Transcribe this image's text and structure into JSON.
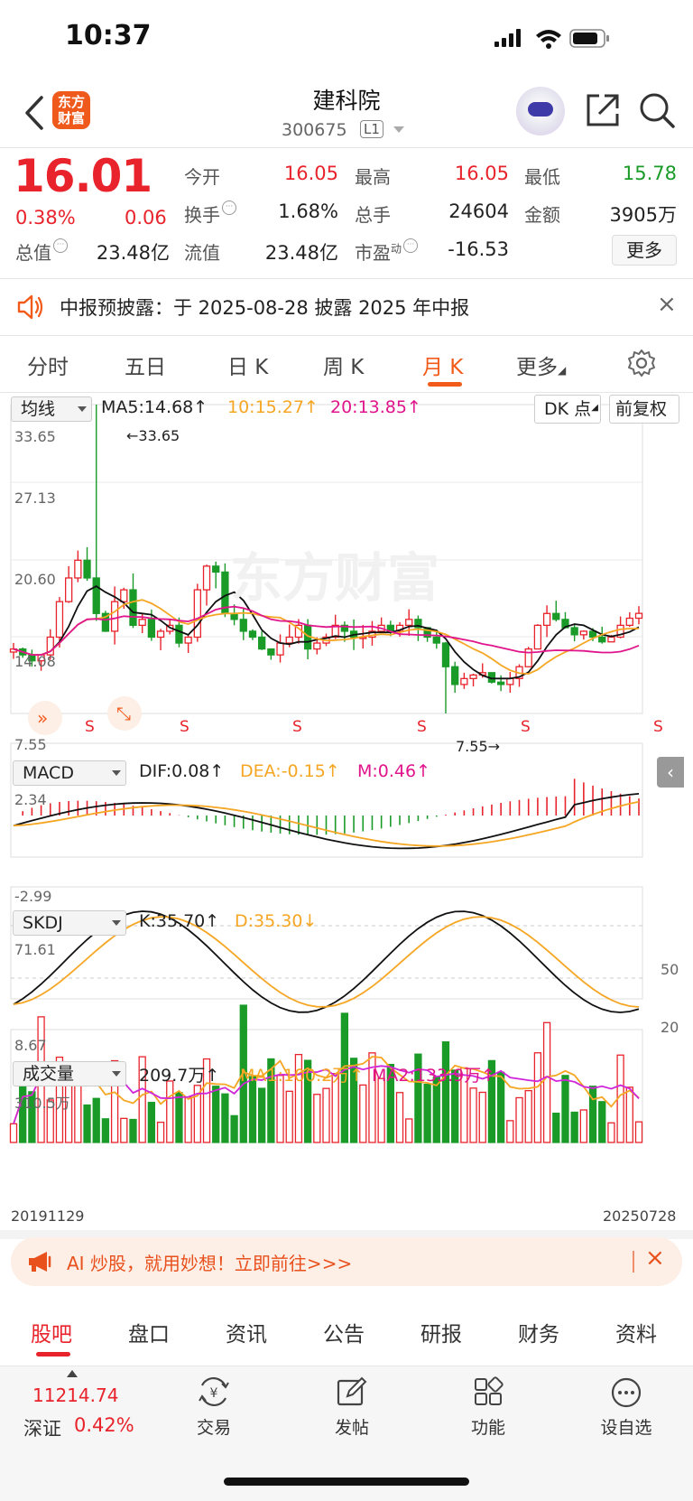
{
  "status_bar": {
    "time": "10:37"
  },
  "header": {
    "name": "建科院",
    "code": "300675",
    "level": "L1",
    "logo_text": "东方财富"
  },
  "quote": {
    "price": "16.01",
    "change_pct": "0.38%",
    "change_abs": "0.06",
    "rows": [
      {
        "label": "今开",
        "value": "16.05",
        "color": "#e8232b"
      },
      {
        "label": "最高",
        "value": "16.05",
        "color": "#e8232b"
      },
      {
        "label": "最低",
        "value": "15.78",
        "color": "#1a9b28"
      },
      {
        "label": "换手",
        "value": "1.68%",
        "color": "#222"
      },
      {
        "label": "总手",
        "value": "24604",
        "color": "#222"
      },
      {
        "label": "金额",
        "value": "3905万",
        "color": "#222"
      },
      {
        "label": "总值",
        "value": "23.48亿",
        "color": "#222"
      },
      {
        "label": "流值",
        "value": "23.48亿",
        "color": "#222"
      },
      {
        "label": "市盈",
        "value": "-16.53",
        "color": "#222"
      }
    ],
    "pe_superscript": "动",
    "more_label": "更多"
  },
  "disclosure": {
    "text": "中报预披露：于 2025-08-28 披露 2025 年中报"
  },
  "kline_tabs": [
    "分时",
    "五日",
    "日 K",
    "周 K",
    "月 K",
    "更多"
  ],
  "main_chart": {
    "ma_select": "均线",
    "ma5": "MA5:14.68",
    "ma10": "10:15.27",
    "ma20": "20:13.85",
    "dk_label": "DK 点",
    "adjust_label": "前复权",
    "y_ticks": [
      "33.65",
      "27.13",
      "20.60",
      "14.08",
      "7.55"
    ],
    "max_marker": "←33.65",
    "min_marker": "7.55→",
    "signal_label": "S",
    "watermark": "东方财富"
  },
  "macd": {
    "select": "MACD",
    "dif": "DIF:0.08",
    "dea": "DEA:-0.15",
    "m": "M:0.46",
    "y_top": "2.34",
    "y_bottom": "-2.99"
  },
  "kdj": {
    "select": "SKDJ",
    "k": "K:35.70",
    "d": "D:35.30",
    "y_top": "71.61",
    "y_bottom": "8.67",
    "level_high": "50",
    "level_low": "20"
  },
  "volume": {
    "select": "成交量",
    "vol": "209.7万",
    "ma1": "MA1:100.2万",
    "ma2": "MA2:133.9万",
    "y_top": "310.5万",
    "date_start": "20191129",
    "date_end": "20250728"
  },
  "ai_banner": {
    "text": "AI 炒股，就用妙想！立即前往>>>"
  },
  "bottom_tabs": [
    "股吧",
    "盘口",
    "资讯",
    "公告",
    "研报",
    "财务",
    "资料"
  ],
  "footer": {
    "index_value": "11214.74",
    "index_name": "深证",
    "index_pct": "0.42%",
    "buttons": [
      "交易",
      "发帖",
      "功能",
      "设自选"
    ]
  },
  "colors": {
    "up": "#e8232b",
    "down": "#1a9b28",
    "accent": "#f25a1a",
    "ma10": "#f5a623",
    "ma20": "#e0158c"
  },
  "chart_data": {
    "type": "candlestick",
    "title": "",
    "period": "monthly",
    "x_range": [
      "20191129",
      "20250728"
    ],
    "ylim": [
      7.55,
      33.65
    ],
    "y_ticks": [
      33.65,
      27.13,
      20.6,
      14.08,
      7.55
    ],
    "series": [
      {
        "name": "MA5",
        "last": 14.68
      },
      {
        "name": "MA10",
        "last": 15.27
      },
      {
        "name": "MA20",
        "last": 13.85
      }
    ],
    "extremes": {
      "max": 33.65,
      "min": 7.55
    },
    "last_close": 16.01
  }
}
